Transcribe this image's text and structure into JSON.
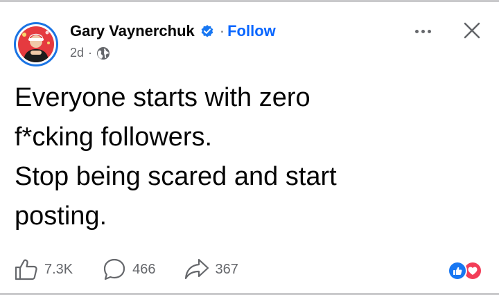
{
  "post": {
    "author": "Gary Vaynerchuk",
    "separator": "·",
    "follow_label": "Follow",
    "timestamp": "2d",
    "meta_separator": "·",
    "audience_icon": "globe-icon",
    "lines": [
      "Everyone starts with zero",
      "f*cking followers.",
      "Stop being scared and start",
      "posting."
    ]
  },
  "actions": {
    "like_count": "7.3K",
    "comment_count": "466",
    "share_count": "367"
  },
  "reactions": [
    "like-icon",
    "love-icon"
  ],
  "colors": {
    "link_blue": "#0866ff",
    "verified_blue": "#1877f2",
    "love_red": "#f33e58",
    "muted_gray": "#65676b",
    "avatar_bg": "#e53a3f"
  }
}
